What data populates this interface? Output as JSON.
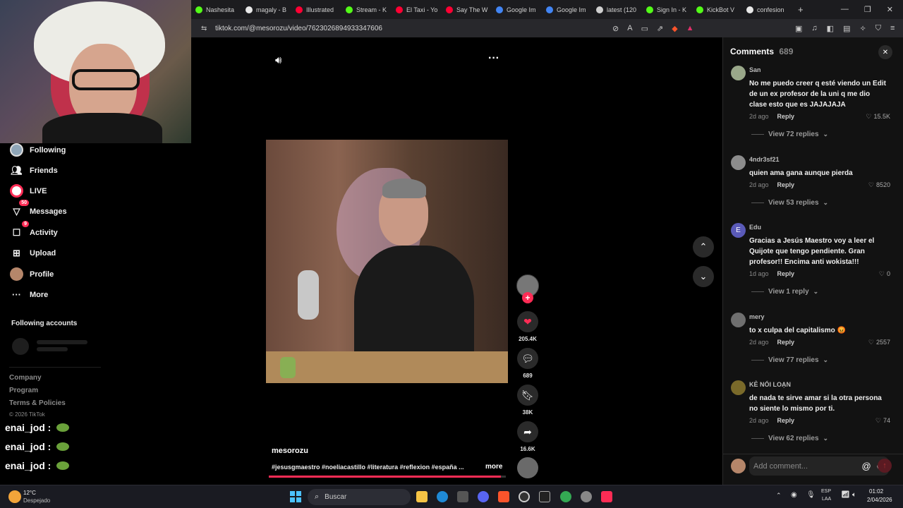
{
  "browser": {
    "tabs": [
      {
        "label": "Nashesita",
        "color": "#53fc18"
      },
      {
        "label": "magaly - B",
        "color": "#e8e8e8"
      },
      {
        "label": "Illustrated",
        "color": "#ff0033"
      },
      {
        "label": "Stream - K",
        "color": "#53fc18"
      },
      {
        "label": "El Taxi - Yo",
        "color": "#ff0033"
      },
      {
        "label": "Say The W",
        "color": "#ff0033"
      },
      {
        "label": "Google Im",
        "color": "#4285f4"
      },
      {
        "label": "Google Im",
        "color": "#4285f4"
      },
      {
        "label": "latest (120",
        "color": "#cfcfcf"
      },
      {
        "label": "Sign In - K",
        "color": "#53fc18"
      },
      {
        "label": "KickBot V",
        "color": "#53fc18"
      },
      {
        "label": "confesion",
        "color": "#e8e8e8"
      }
    ],
    "url": "tiktok.com/@mesorozu/video/7623026894933347606"
  },
  "sidebar": {
    "items": [
      {
        "label": "Following",
        "icon": "following-avatar"
      },
      {
        "label": "Friends",
        "icon": "friends-icon"
      },
      {
        "label": "LIVE",
        "icon": "live-icon"
      },
      {
        "label": "Messages",
        "icon": "messages-icon",
        "badge": "50"
      },
      {
        "label": "Activity",
        "icon": "activity-icon",
        "badge": "9"
      },
      {
        "label": "Upload",
        "icon": "upload-icon"
      },
      {
        "label": "Profile",
        "icon": "profile-avatar"
      },
      {
        "label": "More",
        "icon": "more-icon"
      }
    ],
    "following_accounts_title": "Following accounts",
    "footer": {
      "company": "Company",
      "program": "Program",
      "terms": "Terms & Policies",
      "copyright": "© 2026 TikTok"
    }
  },
  "chat": {
    "lines": [
      "enai_jod :",
      "enai_jod :",
      "enai_jod :"
    ]
  },
  "video": {
    "author": "mesorozu",
    "caption": "#jesusgmaestro #noeliacastillo #literatura #reflexion #españa ...",
    "more_label": "more",
    "progress_percent": 98
  },
  "actions": {
    "likes": "205.4K",
    "comments": "689",
    "saves": "38K",
    "shares": "16.6K"
  },
  "comments_panel": {
    "title": "Comments",
    "count": "689",
    "add_placeholder": "Add comment...",
    "items": [
      {
        "user": "San",
        "text": "No me puedo creer q esté viendo un Edit de un ex profesor de la uni q me dio clase esto que es JAJAJAJA",
        "time": "2d ago",
        "reply": "Reply",
        "likes": "15.5K",
        "view": "View 72 replies",
        "avatar_color": "#9aa88a"
      },
      {
        "user": "4ndr3sf21",
        "text": "quien ama gana aunque pierda",
        "time": "2d ago",
        "reply": "Reply",
        "likes": "8520",
        "view": "View 53 replies",
        "avatar_color": "#8c8c8c"
      },
      {
        "user": "Edu",
        "text": "Gracias a Jesús Maestro voy a leer el Quijote que tengo pendiente. Gran profesor!! Encima anti wokista!!!",
        "time": "1d ago",
        "reply": "Reply",
        "likes": "0",
        "view": "View 1 reply",
        "avatar_color": "#5a5ab8",
        "avatar_letter": "E"
      },
      {
        "user": "mery",
        "text": "to x culpa del capitalismo 😡",
        "time": "2d ago",
        "reply": "Reply",
        "likes": "2557",
        "view": "View 77 replies",
        "avatar_color": "#6f6f6f"
      },
      {
        "user": "KẺ NỔI LOẠN",
        "text": "de nada te sirve amar si la otra persona no siente lo mismo por ti.",
        "time": "2d ago",
        "reply": "Reply",
        "likes": "74",
        "view": "View 62 replies",
        "avatar_color": "#7a6a2a"
      }
    ]
  },
  "taskbar": {
    "weather_temp": "12°C",
    "weather_desc": "Despejado",
    "search_label": "Buscar",
    "lang_top": "ESP",
    "lang_bottom": "LAA",
    "time": "01:02",
    "date": "2/04/2026"
  }
}
